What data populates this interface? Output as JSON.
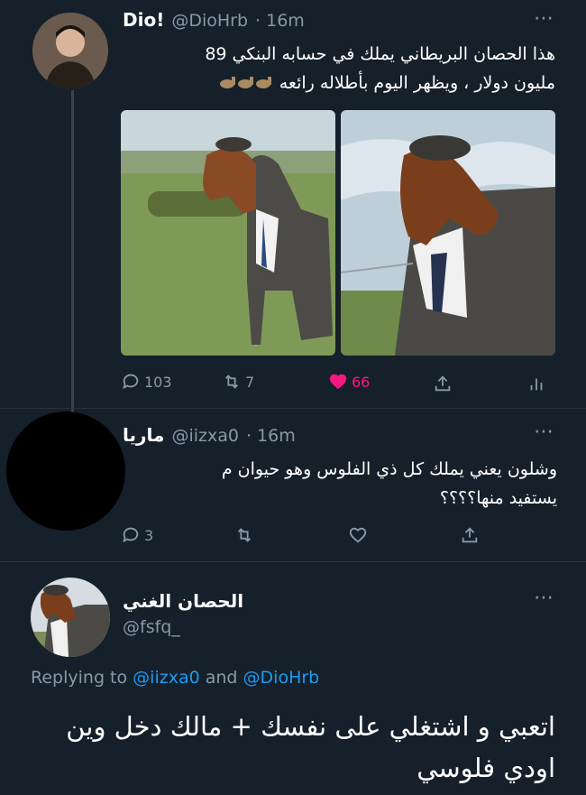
{
  "tweet1": {
    "name": "Dio!",
    "handle": "@DioHrb",
    "time": "· 16m",
    "text_line1": "هذا الحصان البريطاني يملك في حسابه البنكي 89",
    "text_line2": "مليون دولار ، ويظهر اليوم بأطلاله رائعه",
    "stats": {
      "replies": "103",
      "retweets": "7",
      "likes": "66"
    }
  },
  "tweet2": {
    "name": "ماريا",
    "handle": "@iizxa0",
    "time": "· 16m",
    "text_line1": "وشلون يعني يملك كل ذي الفلوس وهو حيوان م",
    "text_line2": "يستفيد منها؟؟؟؟",
    "stats": {
      "replies": "3",
      "retweets": "",
      "likes": ""
    }
  },
  "tweet3": {
    "name": "الحصان الغني",
    "handle": "@fsfq_",
    "replying_prefix": "Replying to",
    "mention1": "@iizxa0",
    "and_word": "and",
    "mention2": "@DioHrb",
    "text_line1": "اتعبي و اشتغلي على نفسك + مالك دخل وين",
    "text_line2": "اودي فلوسي"
  },
  "colors": {
    "background": "#15202b",
    "secondary_text": "#8b98a5",
    "like": "#f91880",
    "link": "#1d9bf0"
  },
  "icons": [
    "more-icon",
    "reply-icon",
    "retweet-icon",
    "heart-icon",
    "share-icon",
    "analytics-icon",
    "horse-emoji"
  ]
}
